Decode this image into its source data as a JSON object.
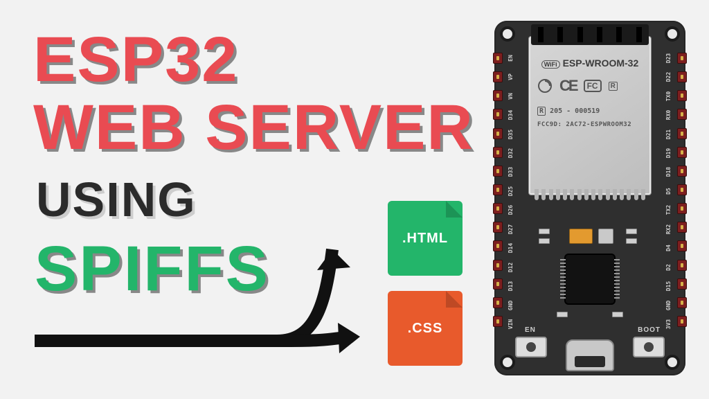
{
  "title": {
    "line1": "ESP32",
    "line2": "WEB SERVER",
    "using": "USING",
    "spiffs": "SPIFFS"
  },
  "files": {
    "html_label": ".HTML",
    "css_label": ".CSS"
  },
  "board": {
    "module_name": "ESP-WROOM-32",
    "wifi_badge": "WiFi",
    "ce": "CE",
    "fcc": "FC",
    "rohs": "R",
    "reg_code": "205 - 000519",
    "fcc_id": "FCC9D: 2AC72-ESPWROOM32",
    "btn_en": "EN",
    "btn_boot": "BOOT",
    "pins_left": [
      "EN",
      "VP",
      "VN",
      "D34",
      "D35",
      "D32",
      "D33",
      "D25",
      "D26",
      "D27",
      "D14",
      "D12",
      "D13",
      "GND",
      "VIN"
    ],
    "pins_right": [
      "D23",
      "D22",
      "TX0",
      "RX0",
      "D21",
      "D19",
      "D18",
      "D5",
      "TX2",
      "RX2",
      "D4",
      "D2",
      "D15",
      "GND",
      "3V3"
    ]
  },
  "colors": {
    "red": "#e94b52",
    "green": "#23b56a",
    "orange": "#e85a2c",
    "board": "#2f2f2f"
  }
}
